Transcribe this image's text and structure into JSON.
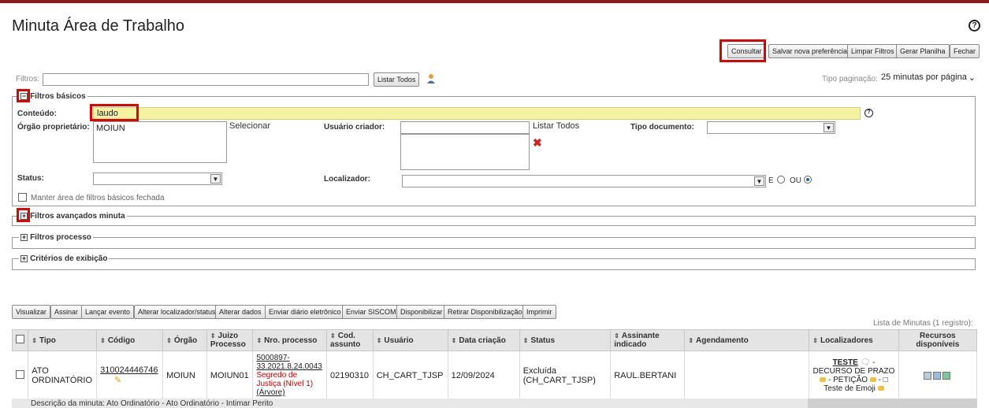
{
  "page": {
    "title": "Minuta Área de Trabalho",
    "help_icon": "question-circle-icon"
  },
  "toolbar_top": {
    "consultar": "Consultar",
    "salvar": "Salvar nova preferência",
    "limpar": "Limpar Filtros",
    "gerar": "Gerar Planilha",
    "fechar": "Fechar"
  },
  "filters_bar": {
    "label": "Filtros:",
    "value": "",
    "listar_todos": "Listar Todos",
    "user_icon": "user-icon",
    "tipo_paginacao_label": "Tipo paginação:",
    "tipo_paginacao_value": "25 minutas por página"
  },
  "basic": {
    "legend": "Filtros básicos",
    "conteudo_label": "Conteúdo:",
    "conteudo_value": "laudo",
    "orgao_label": "Órgão proprietário:",
    "orgao_value": "MOIUN",
    "selecionar": "Selecionar",
    "usuario_label": "Usuário criador:",
    "usuario_value": "",
    "listar_todos": "Listar Todos",
    "tipo_doc_label": "Tipo documento:",
    "tipo_doc_value": "",
    "status_label": "Status:",
    "status_value": "",
    "localizador_label": "Localizador:",
    "localizador_value": "",
    "e_label": "E",
    "ou_label": "OU",
    "manter_label": "Manter área de filtros básicos fechada"
  },
  "sections": {
    "avancados": "Filtros avançados minuta",
    "processo": "Filtros processo",
    "criterios": "Critérios de exibição"
  },
  "actions": {
    "visualizar": "Visualizar",
    "assinar": "Assinar",
    "lancar": "Lançar evento",
    "alterar_loc": "Alterar localizador/status",
    "alterar_dados": "Alterar dados",
    "enviar_diario": "Enviar diário eletrônico",
    "enviar_siscom": "Enviar SISCOM",
    "disponibilizar": "Disponibilizar",
    "retirar": "Retirar Disponibilização",
    "imprimir": "Imprimir"
  },
  "list_caption": "Lista de Minutas (1 registro):",
  "table": {
    "headers": [
      "Tipo",
      "Código",
      "Órgão",
      "Juizo Processo",
      "Nro. processo",
      "Cod. assunto",
      "Usuário",
      "Data criação",
      "Status",
      "Assinante indicado",
      "Agendamento",
      "Localizadores",
      "Recursos disponíveis"
    ],
    "row": {
      "tipo": "ATO ORDINATÓRIO",
      "codigo": "310024446746",
      "orgao": "MOIUN",
      "juizo": "MOIUN01",
      "nro_processo": "5000897-33.2021.8.24.0043",
      "segredo": "Segredo de Justiça (Nível 1)",
      "arvore": "(Árvore)",
      "cod_assunto": "02190310",
      "usuario": "CH_CART_TJSP",
      "data": "12/09/2024",
      "status": "Excluída (CH_CART_TJSP)",
      "assinante": "RAUL.BERTANI",
      "agendamento": "",
      "loc_teste": "TESTE",
      "loc_rest1": " - DECURSO DE PRAZO ",
      "loc_rest2": " - PETIÇÃO ",
      "loc_rest3": " - □ Teste de Emoji "
    }
  },
  "descricao": "Descrição da minuta:  Ato Ordinatório - Ato Ordinatório - Intimar Perito"
}
